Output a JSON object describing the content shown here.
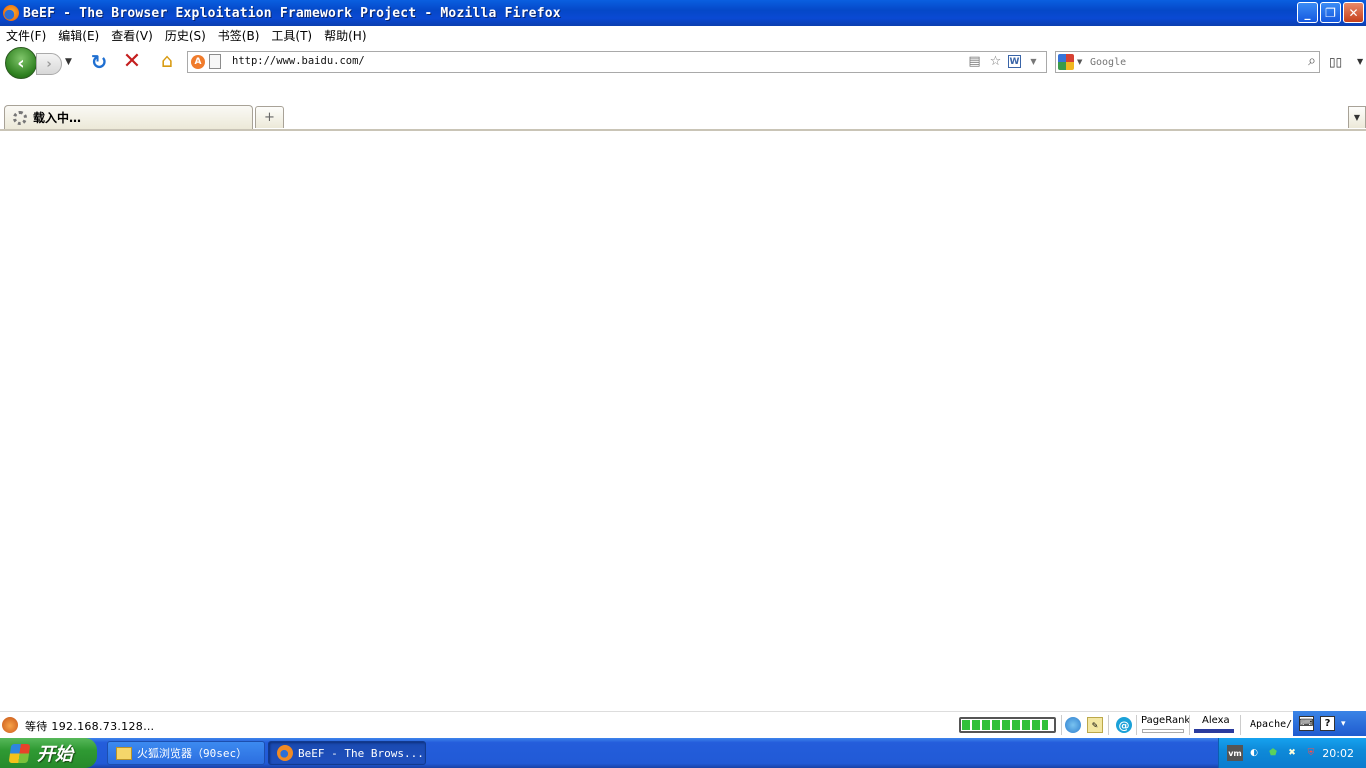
{
  "window": {
    "title": "BeEF - The Browser Exploitation Framework Project - Mozilla Firefox",
    "minimize": "_",
    "restore": "❐",
    "close": "✕"
  },
  "menu": [
    "文件(F)",
    "编辑(E)",
    "查看(V)",
    "历史(S)",
    "书签(B)",
    "工具(T)",
    "帮助(H)"
  ],
  "navigation": {
    "url": "http://www.baidu.com/",
    "search_placeholder": "Google"
  },
  "tabs": [
    {
      "label": "载入中…",
      "loading": true
    }
  ],
  "status": {
    "text": "等待 192.168.73.128…",
    "pagerank_label": "PageRank",
    "alexa_label": "Alexa",
    "apache_label": "Apache/",
    "progress": 0.95,
    "progress_color": "#31c03a"
  },
  "taskbar": {
    "start_label": "开始",
    "tasks": [
      {
        "label": "火狐浏览器（90sec）",
        "icon": "folder-icon"
      },
      {
        "label": "BeEF - The Brows...",
        "icon": "firefox-icon"
      }
    ],
    "clock": "20:02"
  },
  "colors": {
    "titlebar": "#0548c8",
    "taskbar": "#245ddb",
    "start": "#2f9a33",
    "tray": "#0e8ad9"
  }
}
